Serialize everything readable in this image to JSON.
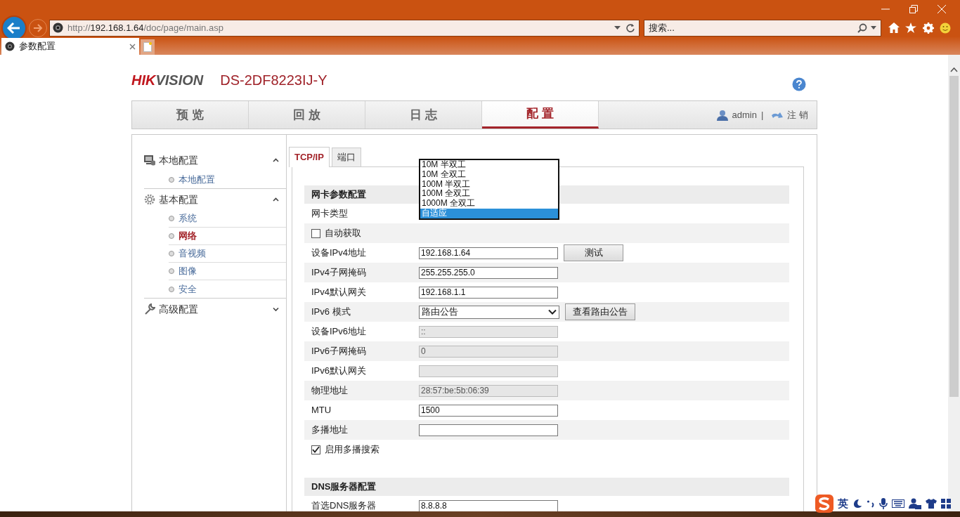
{
  "browser": {
    "url": {
      "scheme": "http://",
      "host": "192.168.1.64",
      "path": "/doc/page/main.asp"
    },
    "search": {
      "placeholder": "搜索..."
    },
    "tabs": [
      {
        "title": "参数配置",
        "selected": true
      }
    ]
  },
  "header": {
    "brand": "HIKVISION",
    "model": "DS-2DF8223IJ-Y"
  },
  "nav": {
    "items": [
      {
        "label": "预 览",
        "selected": false
      },
      {
        "label": "回 放",
        "selected": false
      },
      {
        "label": "日 志",
        "selected": false
      },
      {
        "label": "配 置",
        "selected": true
      }
    ],
    "user": "admin",
    "separator": "|",
    "logout": "注 销"
  },
  "sidebar": [
    {
      "label": "本地配置",
      "expanded": true,
      "children": [
        {
          "label": "本地配置",
          "selected": false
        }
      ]
    },
    {
      "label": "基本配置",
      "expanded": true,
      "children": [
        {
          "label": "系统",
          "selected": false
        },
        {
          "label": "网络",
          "selected": true
        },
        {
          "label": "音视频",
          "selected": false
        },
        {
          "label": "图像",
          "selected": false
        },
        {
          "label": "安全",
          "selected": false
        }
      ]
    },
    {
      "label": "高级配置",
      "expanded": false
    }
  ],
  "subtabs": [
    {
      "label": "TCP/IP",
      "selected": true
    },
    {
      "label": "端口",
      "selected": false
    }
  ],
  "sections": [
    {
      "title": "网卡参数配置",
      "rows": [
        {
          "kind": "select_open",
          "label": "网卡类型",
          "options": [
            {
              "label": "10M 半双工",
              "selected": false
            },
            {
              "label": "10M 全双工",
              "selected": false
            },
            {
              "label": "100M 半双工",
              "selected": false
            },
            {
              "label": "100M 全双工",
              "selected": false
            },
            {
              "label": "1000M 全双工",
              "selected": false
            },
            {
              "label": "自适应",
              "selected": true
            }
          ]
        },
        {
          "kind": "checkbox",
          "label": "自动获取",
          "checked": false
        },
        {
          "kind": "input",
          "label": "设备IPv4地址",
          "value": "192.168.1.64",
          "disabled": false,
          "button": "测试"
        },
        {
          "kind": "input",
          "label": "IPv4子网掩码",
          "value": "255.255.255.0",
          "disabled": false
        },
        {
          "kind": "input",
          "label": "IPv4默认网关",
          "value": "192.168.1.1",
          "disabled": false
        },
        {
          "kind": "select",
          "label": "IPv6 模式",
          "value": "路由公告",
          "button": "查看路由公告"
        },
        {
          "kind": "input",
          "label": "设备IPv6地址",
          "value": "::",
          "disabled": true
        },
        {
          "kind": "input",
          "label": "IPv6子网掩码",
          "value": "0",
          "disabled": true
        },
        {
          "kind": "input",
          "label": "IPv6默认网关",
          "disabled": true
        },
        {
          "kind": "input",
          "label": "物理地址",
          "value": "28:57:be:5b:06:39",
          "disabled": true
        },
        {
          "kind": "input",
          "label": "MTU",
          "value": "1500",
          "disabled": false
        },
        {
          "kind": "input",
          "label": "多播地址",
          "disabled": false
        },
        {
          "kind": "checkbox",
          "label": "启用多播搜索",
          "checked": true
        }
      ]
    },
    {
      "title": "DNS服务器配置",
      "rows": [
        {
          "kind": "input",
          "label": "首选DNS服务器",
          "value": "8.8.8.8",
          "disabled": false
        }
      ]
    }
  ],
  "ime_toolbar": {
    "language": "英"
  }
}
